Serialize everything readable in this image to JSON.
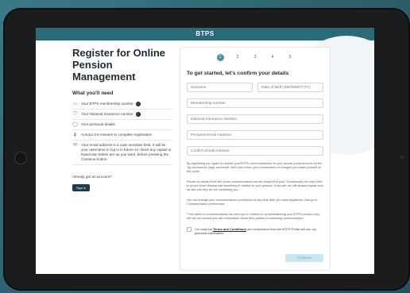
{
  "header": {
    "brand": "BTPS"
  },
  "left": {
    "title": "Register for Online Pension Management",
    "need_title": "What you'll need",
    "items": [
      {
        "icon": "id-card-icon",
        "text": "Your BTPS membership number",
        "info": "i"
      },
      {
        "icon": "shield-icon",
        "text": "Your National Insurance number",
        "info": "i"
      },
      {
        "icon": "person-icon",
        "text": "Your personal details"
      },
      {
        "icon": "hourglass-icon",
        "text": "Around 3-5 minutes to complete registration"
      },
      {
        "icon": "email-icon",
        "text": "Your email address is a case sensitive field. It will be your username to log in in future so check any capital or lowercase letters are as you want, before pressing the Continue button."
      }
    ],
    "already": "Already got an account?",
    "signin": "Sign in"
  },
  "form": {
    "steps": [
      "1",
      "2",
      "3",
      "4",
      "5"
    ],
    "active_step": 1,
    "title": "To get started, let's confirm your details",
    "surname": "Surname",
    "dob": "Date of Birth (DD/MM/YYYY)",
    "membership": "Membership number",
    "ni": "National Insurance Number",
    "email": "Personal Email Address",
    "confirm_email": "Confirm Email Address",
    "para1": "By registering you agree to receive your BTPS communications* to your secure portal account via the 'My documents' page and email. We'll also return your confirmation of changes you make yourself on the portal.",
    "para2": "Please be aware there are some communications we are required to post. Occasionally we may need to phone when issuing info something in relation to your pension. If we call, we will always explain who we are and why we are contacting you.",
    "para3": "You can change your communications preference at any time after you have registered. Just go to Communication preferences.",
    "para4": "*This refers to communications we send you in relation to us administering your BTPS pension only. We will not contact you with information about third parties or marketing communication.",
    "consent_pre": "I've read the",
    "consent_link": "Terms and Conditions",
    "consent_post": "and understand how the BTPS Portal will use my personal information.",
    "continue": "Continue"
  }
}
